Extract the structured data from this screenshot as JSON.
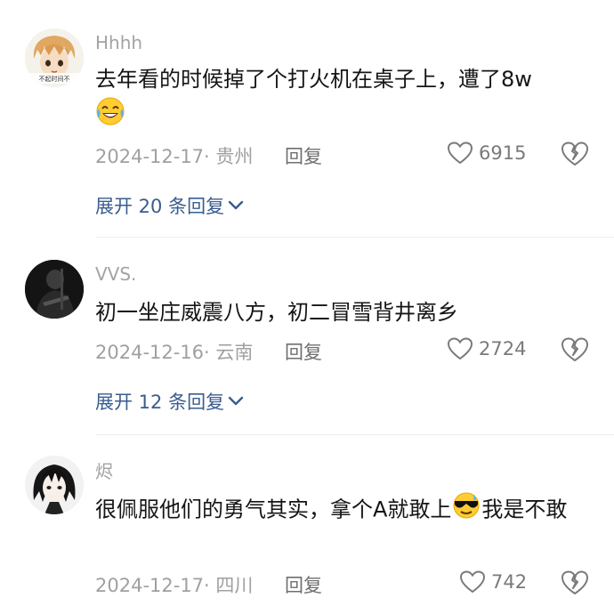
{
  "comments": [
    {
      "username": "Hhhh",
      "text": "去年看的时候掉了个打火机在桌子上，遭了8w",
      "emoji": "laughing-crying-face",
      "date": "2024-12-17",
      "location": "· 贵州",
      "reply_label": "回复",
      "likes": "6915",
      "expand_label": "展开 20 条回复",
      "avatar": "anime-boy-blond-hair",
      "avatar_caption": "不起时间不"
    },
    {
      "username": "VVS.",
      "text": "初一坐庄威震八方，初二冒雪背井离乡",
      "date": "2024-12-16",
      "location": "· 云南",
      "reply_label": "回复",
      "likes": "2724",
      "expand_label": "展开 12 条回复",
      "avatar": "dark-photo-person"
    },
    {
      "username": "烬",
      "text_before": "很佩服他们的勇气其实，拿个A就敢上",
      "emoji": "sunglasses-sweat-face",
      "text_after": "我是不敢",
      "date": "2024-12-17",
      "location": "· 四川",
      "reply_label": "回复",
      "likes": "742",
      "avatar": "anime-boy-black-hair"
    }
  ],
  "icons": {
    "like": "heart-outline-icon",
    "dislike": "broken-heart-icon",
    "expand": "chevron-down-icon"
  },
  "colors": {
    "link": "#3a5d8f",
    "muted": "#a0a0a0",
    "text": "#151515"
  }
}
